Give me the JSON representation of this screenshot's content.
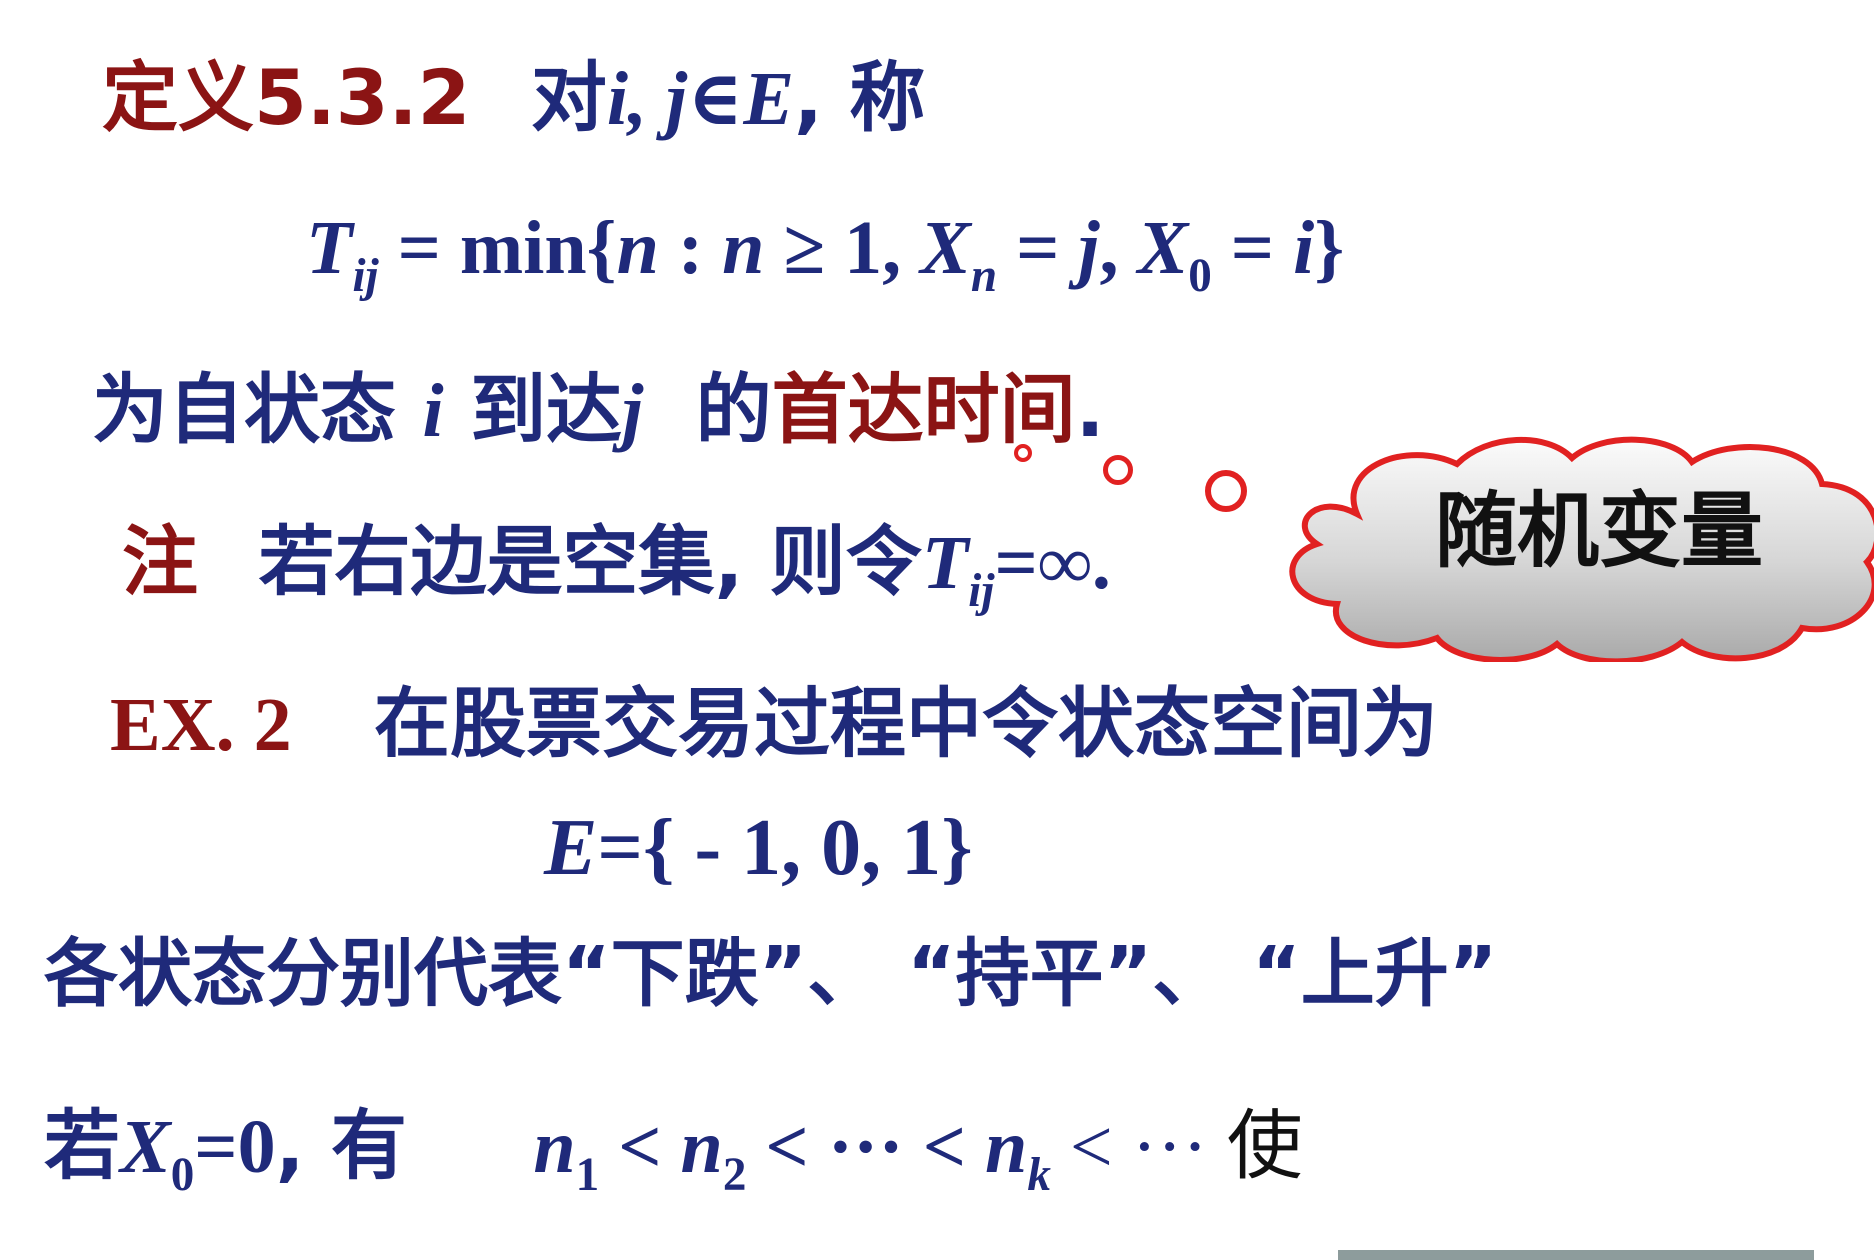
{
  "definition": {
    "label": "定义5.3.2",
    "pre": "对",
    "math": "i, j∈E",
    "post": ", 称"
  },
  "formula": {
    "T": "T",
    "ij": "ij",
    "eq1": " = min{",
    "n1": "n",
    "colon": " : ",
    "n2": "n",
    "geq": " ≥ 1, ",
    "X": "X",
    "n_sub": "n",
    "eq2": " = ",
    "j": "j",
    "comma": ", ",
    "X0": "X",
    "zero": "0",
    "eq3": " = ",
    "i": "i",
    "close": "}"
  },
  "line2": {
    "a": "为自状态",
    "i": "i",
    "b": "到达",
    "j": "j",
    "c": "的",
    "highlight": "首达时间",
    "dot": "."
  },
  "note": {
    "label": "注",
    "text": "若右边是空集, 则令",
    "T": "T",
    "ij": "ij",
    "tail": "=∞."
  },
  "callout": {
    "text": "随机变量"
  },
  "example": {
    "label": "EX. 2",
    "text": "在股票交易过程中令状态空间为"
  },
  "set_line": {
    "E": "E",
    "rest": "={ - 1, 0, 1}"
  },
  "states_line": {
    "text": "各状态分别代表“下跌”、 “持平”、 “上升”"
  },
  "last_line": {
    "prefix": "若",
    "X": "X",
    "zero": "0",
    "eq": "=0",
    "you": ",  有",
    "n": "n",
    "s1": "1",
    "lt1": " < ",
    "s2": "2",
    "lt2": " < ··· < ",
    "sk": "k",
    "lt3": " < ··· ",
    "shi": "使"
  }
}
